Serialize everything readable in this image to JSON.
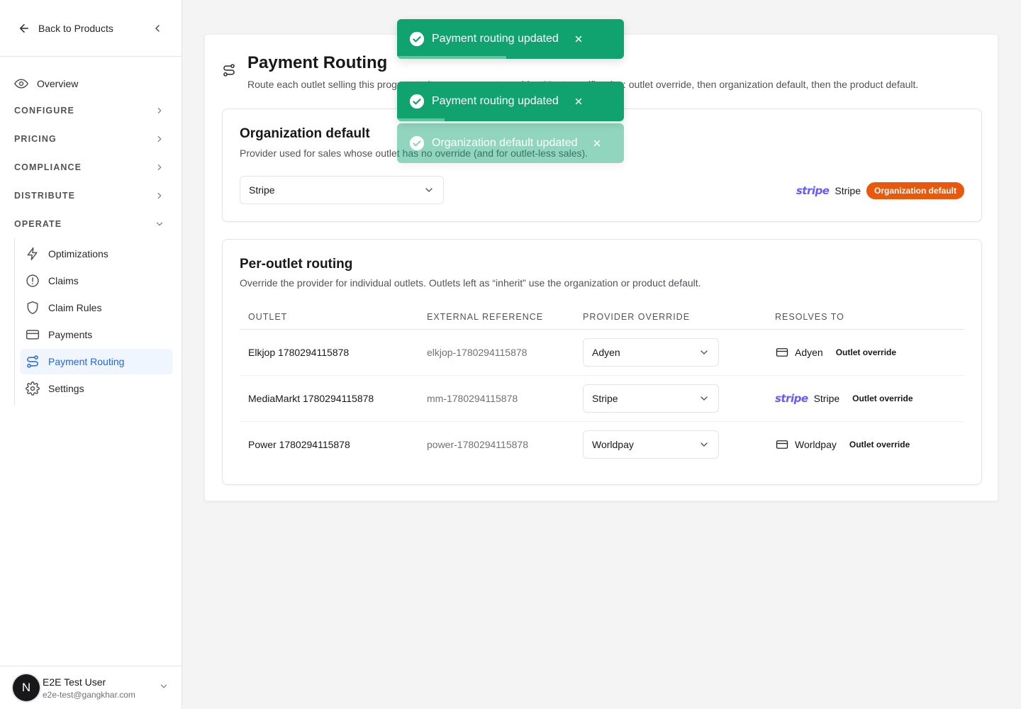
{
  "sidebar": {
    "back_label": "Back to Products",
    "overview": "Overview",
    "sections": [
      {
        "label": "CONFIGURE"
      },
      {
        "label": "PRICING"
      },
      {
        "label": "COMPLIANCE"
      },
      {
        "label": "DISTRIBUTE"
      },
      {
        "label": "OPERATE"
      }
    ],
    "operate_items": [
      {
        "label": "Optimizations",
        "icon": "lightning-icon"
      },
      {
        "label": "Claims",
        "icon": "alert-circle-icon"
      },
      {
        "label": "Claim Rules",
        "icon": "shield-icon"
      },
      {
        "label": "Payments",
        "icon": "credit-card-icon"
      },
      {
        "label": "Payment Routing",
        "icon": "route-icon",
        "active": true
      },
      {
        "label": "Settings",
        "icon": "gear-icon"
      }
    ],
    "user": {
      "initial": "N",
      "name": "E2E Test User",
      "email": "e2e-test@gangkhar.com"
    }
  },
  "page": {
    "title": "Payment Routing",
    "description": "Route each outlet selling this program to its own payment provider. Most specific wins: outlet override, then organization default, then the product default."
  },
  "org_default": {
    "title": "Organization default",
    "description": "Provider used for sales whose outlet has no override (and for outlet-less sales).",
    "selected": "Stripe",
    "resolved_logo": "stripe",
    "resolved_name": "Stripe",
    "badge": "Organization default"
  },
  "per_outlet": {
    "title": "Per-outlet routing",
    "description": "Override the provider for individual outlets. Outlets left as “inherit” use the organization or product default.",
    "columns": [
      "OUTLET",
      "EXTERNAL REFERENCE",
      "PROVIDER OVERRIDE",
      "RESOLVES TO"
    ],
    "rows": [
      {
        "outlet": "Elkjop 1780294115878",
        "ref": "elkjop-1780294115878",
        "override": "Adyen",
        "resolves": "Adyen",
        "resolve_icon": "credit-card-icon",
        "tag": "Outlet override"
      },
      {
        "outlet": "MediaMarkt 1780294115878",
        "ref": "mm-1780294115878",
        "override": "Stripe",
        "resolves": "Stripe",
        "resolve_icon": "stripe",
        "logo_text": "stripe",
        "tag": "Outlet override"
      },
      {
        "outlet": "Power 1780294115878",
        "ref": "power-1780294115878",
        "override": "Worldpay",
        "resolves": "Worldpay",
        "resolve_icon": "credit-card-icon",
        "tag": "Outlet override"
      }
    ]
  },
  "toasts": [
    {
      "message": "Payment routing updated",
      "progress": 0.48
    },
    {
      "message": "Payment routing updated",
      "progress": 0.21
    },
    {
      "message": "Organization default updated",
      "progress": 0.0
    }
  ],
  "colors": {
    "accent": "#2563eb",
    "toast": "#10a370",
    "org_badge": "#ea580c",
    "stripe": "#635bff"
  }
}
